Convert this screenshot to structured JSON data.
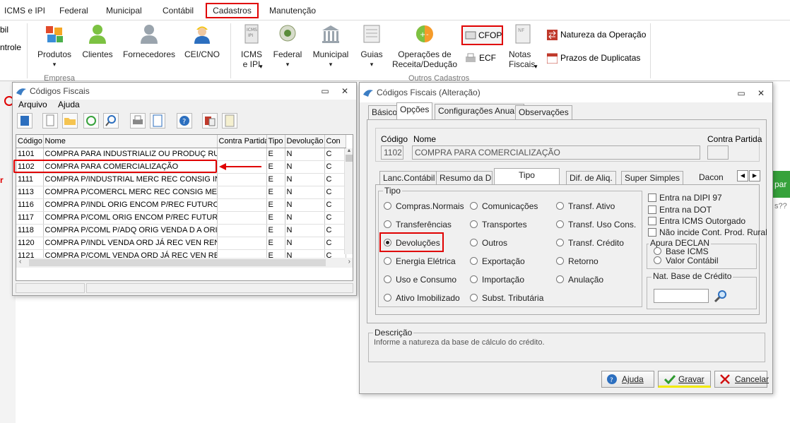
{
  "menu": {
    "tabs": [
      "ICMS e IPI",
      "Federal",
      "Municipal",
      "Contábil",
      "Cadastros",
      "Manutenção"
    ],
    "active": "Cadastros"
  },
  "ribbon": {
    "left_cut": [
      "bil",
      "ntrole"
    ],
    "empresa_items": [
      "Produtos",
      "Clientes",
      "Fornecedores",
      "CEI/CNO"
    ],
    "empresa_label": "Empresa",
    "icms_ipi": "ICMS\ne IPI",
    "federal": "Federal",
    "municipal": "Municipal",
    "guias": "Guias",
    "operacoes": "Operações de\nReceita/Dedução",
    "cfop": "CFOP",
    "ecf": "ECF",
    "notas": "Notas\nFiscais",
    "natureza": "Natureza da Operação",
    "prazos": "Prazos de Duplicatas",
    "outros_label": "Outros Cadastros"
  },
  "left_window": {
    "title": "Códigos Fiscais",
    "menu": [
      "Arquivo",
      "Ajuda"
    ],
    "columns": [
      "Código",
      "Nome",
      "Contra Partida",
      "Tipo",
      "Devolução",
      "Con"
    ],
    "rows": [
      [
        "1101",
        "COMPRA PARA INDUSTRIALIZ OU PRODUÇ RU",
        "",
        "E",
        "N",
        "C"
      ],
      [
        "1102",
        "COMPRA PARA COMERCIALIZAÇÃO",
        "",
        "E",
        "N",
        "C"
      ],
      [
        "1111",
        "COMPRA P/INDUSTRIAL MERC REC CONSIG IN",
        "",
        "E",
        "N",
        "C"
      ],
      [
        "1113",
        "COMPRA P/COMERCL MERC REC CONSIG MEF",
        "",
        "E",
        "N",
        "C"
      ],
      [
        "1116",
        "COMPRA P/INDL ORIG ENCOM P/REC FUTURC",
        "",
        "E",
        "N",
        "C"
      ],
      [
        "1117",
        "COMPRA P/COML ORIG ENCOM P/REC FUTUR",
        "",
        "E",
        "N",
        "C"
      ],
      [
        "1118",
        "COMPRA P/COML P/ADQ ORIG VENDA D A ORI",
        "",
        "E",
        "N",
        "C"
      ],
      [
        "1120",
        "COMPRA P/INDL VENDA ORD JÁ REC VEN REN",
        "",
        "E",
        "N",
        "C"
      ],
      [
        "1121",
        "COMPRA P/COML VENDA ORD JÁ REC VEN RE",
        "",
        "E",
        "N",
        "C"
      ]
    ]
  },
  "right_window": {
    "title": "Códigos Fiscais (Alteração)",
    "tabs": [
      "Básico",
      "Opções",
      "Configurações Anuais",
      "Observações"
    ],
    "codigo_label": "Código",
    "nome_label": "Nome",
    "contra_label": "Contra Partida",
    "codigo_value": "1102",
    "nome_value": "COMPRA PARA COMERCIALIZAÇÃO",
    "subtabs": [
      "Lanc.Contábil",
      "Resumo da DIPI",
      "Tipo",
      "Dif. de Aliq.",
      "Super Simples",
      "Dacon"
    ],
    "tipo_label": "Tipo",
    "tipo_options": [
      [
        "Compras.Normais",
        "Comunicações",
        "Transf. Ativo"
      ],
      [
        "Transferências",
        "Transportes",
        "Transf. Uso Cons."
      ],
      [
        "Devoluções",
        "Outros",
        "Transf. Crédito"
      ],
      [
        "Energia Elétrica",
        "Exportação",
        "Retorno"
      ],
      [
        "Uso e Consumo",
        "Importação",
        "Anulação"
      ],
      [
        "Ativo Imobilizado",
        "Subst. Tributária",
        ""
      ]
    ],
    "tipo_selected": "Devoluções",
    "checks": [
      "Entra na DIPI 97",
      "Entra na DOT",
      "Entra ICMS Outorgado",
      "Não incide Cont. Prod. Rural"
    ],
    "apura_label": "Apura DECLAN",
    "apura_options": [
      "Base ICMS",
      "Valor Contábil"
    ],
    "nat_label": "Nat. Base de Crédito",
    "descricao_label": "Descrição",
    "descricao_text": "Informe a natureza da base de cálculo do crédito.",
    "buttons": [
      "Ajuda",
      "Gravar",
      "Cancelar"
    ]
  },
  "background": {
    "right_cut": "par",
    "right_cut2": "s??",
    "left_cut": "r"
  }
}
